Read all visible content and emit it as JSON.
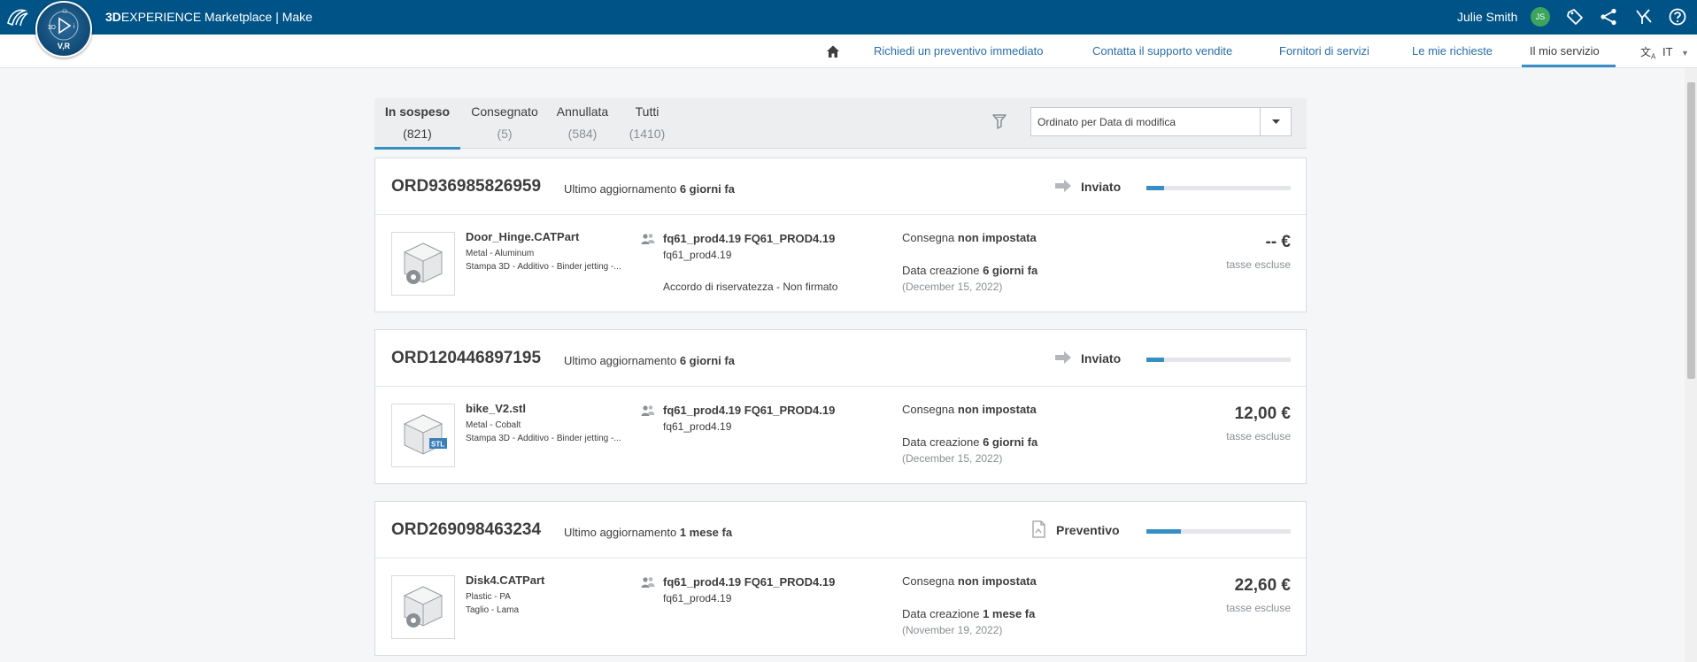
{
  "app": {
    "brand_bold": "3D",
    "brand_rest": "EXPERIENCE Marketplace",
    "separator": " | ",
    "section": "Make",
    "compass_version": "V,R",
    "user_name": "Julie Smith",
    "user_initials": "JS"
  },
  "nav": {
    "links": [
      "Richiedi un preventivo immediato",
      "Contatta il supporto vendite",
      "Fornitori di servizi",
      "Le mie richieste",
      "Il mio servizio"
    ],
    "active_index": 4,
    "language": "IT"
  },
  "tabs": [
    {
      "label": "In sospeso",
      "count": "(821)"
    },
    {
      "label": "Consegnato",
      "count": "(5)"
    },
    {
      "label": "Annullata",
      "count": "(584)"
    },
    {
      "label": "Tutti",
      "count": "(1410)"
    }
  ],
  "sort": {
    "selected": "Ordinato per Data di modifica"
  },
  "orders": [
    {
      "id": "ORD936985826959",
      "updated_label": "Ultimo aggiornamento",
      "updated_value": "6 giorni fa",
      "status": "Inviato",
      "status_icon": "arrow-right-icon",
      "progress": 0.12,
      "part_name": "Door_Hinge.CATPart",
      "material": "Metal - Aluminum",
      "process": "Stampa 3D - Additivo - Binder jetting -...",
      "provider": "fq61_prod4.19 FQ61_PROD4.19",
      "provider_sub": "fq61_prod4.19",
      "nda": "Accordo di riservatezza - Non firmato",
      "delivery_label": "Consegna",
      "delivery_value": "non impostata",
      "created_label": "Data creazione",
      "created_value": "6 giorni fa",
      "created_date": "(December 15, 2022)",
      "price": "-- €",
      "tax": "tasse escluse",
      "thumb": "catpart-gear-icon"
    },
    {
      "id": "ORD120446897195",
      "updated_label": "Ultimo aggiornamento",
      "updated_value": "6 giorni fa",
      "status": "Inviato",
      "status_icon": "arrow-right-icon",
      "progress": 0.12,
      "part_name": "bike_V2.stl",
      "material": "Metal - Cobalt",
      "process": "Stampa 3D - Additivo - Binder jetting -...",
      "provider": "fq61_prod4.19 FQ61_PROD4.19",
      "provider_sub": "fq61_prod4.19",
      "nda": "",
      "delivery_label": "Consegna",
      "delivery_value": "non impostata",
      "created_label": "Data creazione",
      "created_value": "6 giorni fa",
      "created_date": "(December 15, 2022)",
      "price": "12,00 €",
      "tax": "tasse escluse",
      "thumb": "stl-file-icon"
    },
    {
      "id": "ORD269098463234",
      "updated_label": "Ultimo aggiornamento",
      "updated_value": "1 mese fa",
      "status": "Preventivo",
      "status_icon": "document-icon",
      "progress": 0.24,
      "part_name": "Disk4.CATPart",
      "material": "Plastic - PA",
      "process": "Taglio - Lama",
      "provider": "fq61_prod4.19 FQ61_PROD4.19",
      "provider_sub": "fq61_prod4.19",
      "nda": "",
      "delivery_label": "Consegna",
      "delivery_value": "non impostata",
      "created_label": "Data creazione",
      "created_value": "1 mese fa",
      "created_date": "(November 19, 2022)",
      "price": "22,60 €",
      "tax": "tasse escluse",
      "thumb": "catpart-gear-icon"
    }
  ]
}
